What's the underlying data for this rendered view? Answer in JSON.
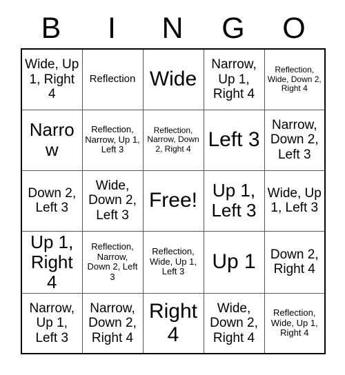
{
  "card": {
    "title_letters": [
      "B",
      "I",
      "N",
      "G",
      "O"
    ],
    "columns": 5,
    "rows": 5,
    "free_space_text": "Free!",
    "free_space_position": {
      "row": 3,
      "col": 3
    },
    "colors": {
      "text": "#000000",
      "background": "#ffffff",
      "cell_border": "#555555",
      "grid_border": "#000000"
    },
    "cells": [
      [
        {
          "text": "Wide, Up 1, Right 4",
          "size": "md"
        },
        {
          "text": "Reflection",
          "size": "sm"
        },
        {
          "text": "Wide",
          "size": "xl"
        },
        {
          "text": "Narrow, Up 1, Right 4",
          "size": "md"
        },
        {
          "text": "Reflection, Wide, Down 2, Right 4",
          "size": "xxs"
        }
      ],
      [
        {
          "text": "Narrow",
          "size": "lg"
        },
        {
          "text": "Reflection, Narrow, Up 1, Left 3",
          "size": "xs"
        },
        {
          "text": "Reflection, Narrow, Down 2, Right 4",
          "size": "xxs"
        },
        {
          "text": "Left 3",
          "size": "xl"
        },
        {
          "text": "Narrow, Down 2, Left 3",
          "size": "md"
        }
      ],
      [
        {
          "text": "Down 2, Left 3",
          "size": "md"
        },
        {
          "text": "Wide, Down 2, Left 3",
          "size": "md"
        },
        {
          "text": "Free!",
          "size": "xl"
        },
        {
          "text": "Up 1, Left 3",
          "size": "lg"
        },
        {
          "text": "Wide, Up 1, Left 3",
          "size": "md"
        }
      ],
      [
        {
          "text": "Up 1, Right 4",
          "size": "lg"
        },
        {
          "text": "Reflection, Narrow, Down 2, Left 3",
          "size": "xs"
        },
        {
          "text": "Reflection, Wide, Up 1, Left 3",
          "size": "xs"
        },
        {
          "text": "Up 1",
          "size": "xl"
        },
        {
          "text": "Down 2, Right 4",
          "size": "md"
        }
      ],
      [
        {
          "text": "Narrow, Up 1, Left 3",
          "size": "md"
        },
        {
          "text": "Narrow, Down 2, Right 4",
          "size": "md"
        },
        {
          "text": "Right 4",
          "size": "xl"
        },
        {
          "text": "Wide, Down 2, Right 4",
          "size": "md"
        },
        {
          "text": "Reflection, Wide, Up 1, Right 4",
          "size": "xs"
        }
      ]
    ]
  }
}
